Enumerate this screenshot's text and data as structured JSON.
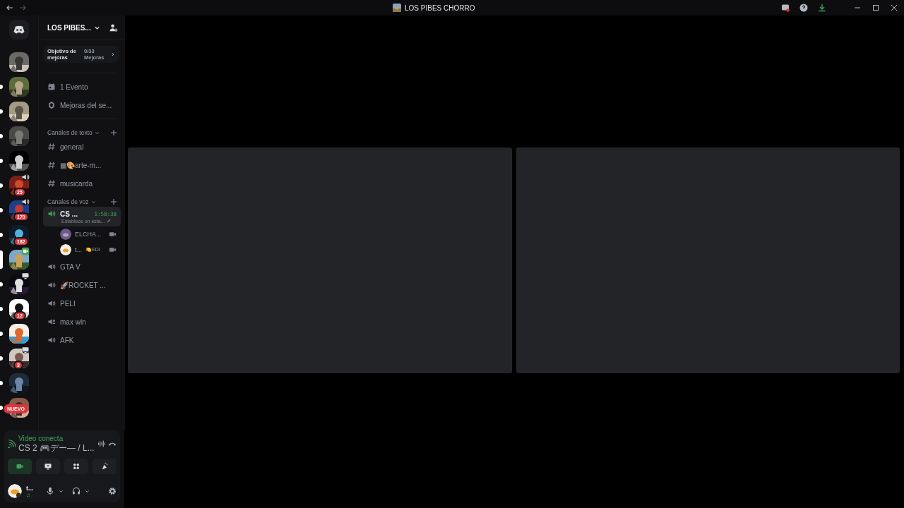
{
  "window": {
    "title": "LOS PIBES CHORRO"
  },
  "servers": [
    {
      "kind": "plain",
      "unread": false,
      "selected": false
    },
    {
      "kind": "plain",
      "unread": true,
      "selected": false
    },
    {
      "kind": "plain",
      "unread": true,
      "selected": false
    },
    {
      "kind": "plain",
      "unread": true,
      "selected": false
    },
    {
      "kind": "plain",
      "unread": true,
      "selected": false
    },
    {
      "kind": "voice",
      "unread": true,
      "selected": false,
      "badge": "25"
    },
    {
      "kind": "voice",
      "unread": true,
      "selected": false,
      "badge": "170"
    },
    {
      "kind": "plain",
      "unread": true,
      "selected": false,
      "badge": "182"
    },
    {
      "kind": "video",
      "selected": true
    },
    {
      "kind": "screen",
      "unread": true,
      "selected": false
    },
    {
      "kind": "plain",
      "unread": true,
      "selected": false,
      "badge": "12"
    },
    {
      "kind": "plain",
      "unread": true,
      "selected": false
    },
    {
      "kind": "screen",
      "unread": true,
      "selected": false,
      "badge": "3"
    },
    {
      "kind": "plain",
      "unread": true,
      "selected": false
    },
    {
      "kind": "plain",
      "unread": true,
      "selected": false
    }
  ],
  "new_badge": "NUEVO",
  "server_name": "LOS PIBES...",
  "boost_goal": {
    "label": "Objetivo de mejoras",
    "count": "0/33",
    "unit": "Mejoras"
  },
  "nav": [
    {
      "kind": "event",
      "label": "1 Evento"
    },
    {
      "kind": "boost",
      "label": "Mejoras del se..."
    }
  ],
  "categories": [
    {
      "name": "Canales de texto",
      "channels": [
        {
          "kind": "text",
          "name": "general",
          "selected": false
        },
        {
          "kind": "text",
          "name": "▦🎨arte-m...",
          "selected": false
        },
        {
          "kind": "text",
          "name": "musicarda",
          "selected": false
        }
      ]
    },
    {
      "name": "Canales de voz",
      "channels": [
        {
          "kind": "voice",
          "name": "CS ...",
          "selected": true,
          "timer": "1:58:38",
          "status": "Establece un esta...",
          "members": [
            {
              "name": "ELCHA...",
              "video": true
            },
            {
              "name": "t...",
              "activity": "🍋EDI",
              "video": true
            }
          ]
        },
        {
          "kind": "voice",
          "name": "GTA V",
          "selected": false
        },
        {
          "kind": "voice",
          "name": "🚀ROCKET ...",
          "selected": false
        },
        {
          "kind": "voice",
          "name": "PELI",
          "selected": false
        },
        {
          "kind": "stage",
          "name": "max win",
          "selected": false
        },
        {
          "kind": "voice",
          "name": "AFK",
          "selected": false
        }
      ]
    }
  ],
  "voice_panel": {
    "status": "Video conecta",
    "channel": "CS 2 🎮デー― / L...",
    "buttons": [
      {
        "kind": "camera",
        "selected": true
      },
      {
        "kind": "screen",
        "selected": false
      },
      {
        "kind": "activities",
        "selected": false
      },
      {
        "kind": "soundboard",
        "selected": false
      }
    ]
  },
  "user": {
    "name": "t...",
    "status": "♫"
  },
  "video_tiles": [
    {
      "kind": "empty"
    },
    {
      "kind": "empty"
    }
  ]
}
